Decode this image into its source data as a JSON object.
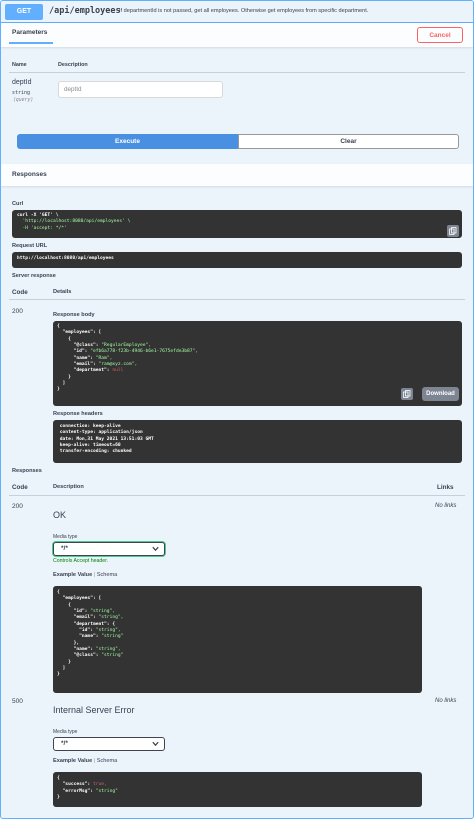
{
  "summary": {
    "method": "GET",
    "path": "/api/employees",
    "description": "If departmentId is not passed, get all employees. Otherwise get employees from specific department."
  },
  "params_section": {
    "tab_label": "Parameters",
    "cancel_label": "Cancel",
    "col_name": "Name",
    "col_description": "Description",
    "param": {
      "name": "deptId",
      "type": "string",
      "location": "(query)",
      "placeholder": "deptId",
      "value": ""
    }
  },
  "actions": {
    "execute_label": "Execute",
    "clear_label": "Clear"
  },
  "responses_header": "Responses",
  "curl": {
    "label": "Curl",
    "lines": [
      "curl -X 'GET' \\",
      "  'http://localhost:8080/api/employees' \\",
      "  -H 'accept: */*'"
    ]
  },
  "request_url": {
    "label": "Request URL",
    "value": "http://localhost:8080/api/employees"
  },
  "server_response": {
    "label": "Server response",
    "col_code": "Code",
    "col_details": "Details",
    "code": "200",
    "body_label": "Response body",
    "body_lines": [
      "{",
      "  \"employees\": [",
      "    {",
      "      \"@class\": \"RegularEmployee\",",
      "      \"id\": \"efb6a778-f23b-4946-b6e1-7675efde3b87\",",
      "      \"name\": \"Ram\",",
      "      \"email\": \"ram@xyz.com\",",
      "      \"department\": null",
      "    }",
      "  ]",
      "}"
    ],
    "download_label": "Download",
    "headers_label": "Response headers",
    "headers_lines": [
      " connection: keep-alive",
      " content-type: application/json",
      " date: Mon,31 May 2021 13:51:03 GMT",
      " keep-alive: timeout=60",
      " transfer-encoding: chunked"
    ]
  },
  "responses": {
    "label": "Responses",
    "col_code": "Code",
    "col_description": "Description",
    "col_links": "Links",
    "items": [
      {
        "code": "200",
        "title": "OK",
        "no_links": "No links",
        "media_type_label": "Media type",
        "media_type": "*/*",
        "controls_text": "Controls Accept header.",
        "example_label": "Example Value",
        "schema_label": "Schema",
        "example_lines": [
          "{",
          "  \"employees\": [",
          "    {",
          "      \"id\": \"string\",",
          "      \"email\": \"string\",",
          "      \"department\": {",
          "        \"id\": \"string\",",
          "        \"name\": \"string\"",
          "      },",
          "      \"name\": \"string\",",
          "      \"@class\": \"string\"",
          "    }",
          "  ]",
          "}"
        ]
      },
      {
        "code": "500",
        "title": "Internal Server Error",
        "no_links": "No links",
        "media_type_label": "Media type",
        "media_type": "*/*",
        "example_label": "Example Value",
        "schema_label": "Schema",
        "example_lines": [
          "{",
          "  \"success\": true,",
          "  \"errorMsg\": \"string\"",
          "}"
        ]
      }
    ]
  },
  "colors": {
    "get_blue": "#61affe",
    "execute_blue": "#4990e2",
    "cancel_red": "#ff6060",
    "code_bg": "#333333",
    "string_green": "#a2fca2",
    "valid_green": "#49cc90"
  }
}
